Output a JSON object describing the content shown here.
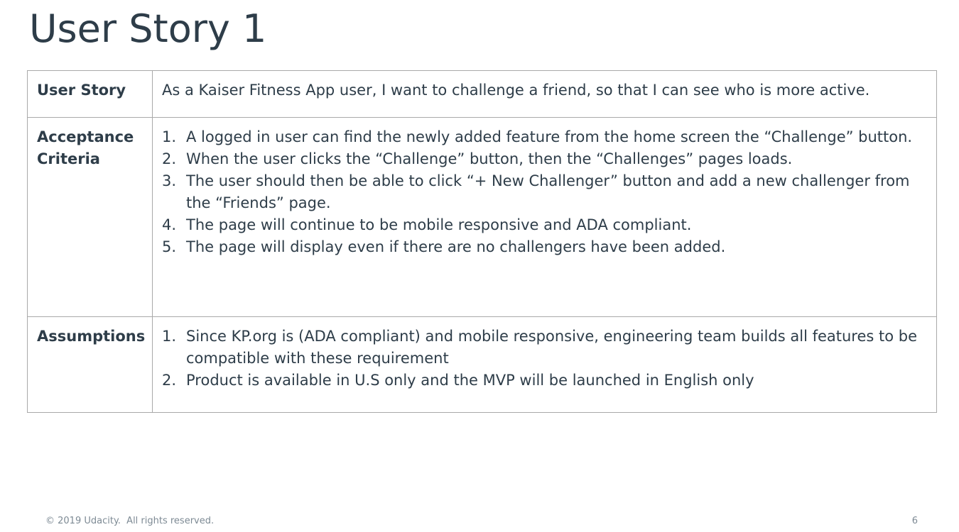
{
  "slide": {
    "title": "User Story 1",
    "footer": "© 2019 Udacity.  All rights reserved.",
    "page_number": "6"
  },
  "table": {
    "story": {
      "label": "User Story",
      "text": "As a Kaiser Fitness App user, I want to challenge a friend, so that I can see who is more active."
    },
    "criteria": {
      "label_line1": "Acceptance",
      "label_line2": "Criteria",
      "items": [
        {
          "num": "1.",
          "text": "A logged in user can find the newly added feature from the home screen the “Challenge” button."
        },
        {
          "num": "2.",
          "text": "When the user clicks the “Challenge” button, then the “Challenges” pages loads."
        },
        {
          "num": "3.",
          "text": "The user should then be able to click “+ New Challenger” button and add a new challenger from the “Friends” page."
        },
        {
          "num": "4.",
          "text": "The page will continue to be mobile responsive and ADA compliant."
        },
        {
          "num": "5.",
          "text": "The page will display even if there are no challengers have been added."
        }
      ]
    },
    "assumptions": {
      "label": "Assumptions",
      "items": [
        {
          "num": "1.",
          "text": "Since KP.org is (ADA compliant) and mobile responsive, engineering team builds all features to be compatible with these requirement"
        },
        {
          "num": "2.",
          "text": "Product is available in U.S only and the MVP will be launched in English only"
        }
      ]
    }
  }
}
